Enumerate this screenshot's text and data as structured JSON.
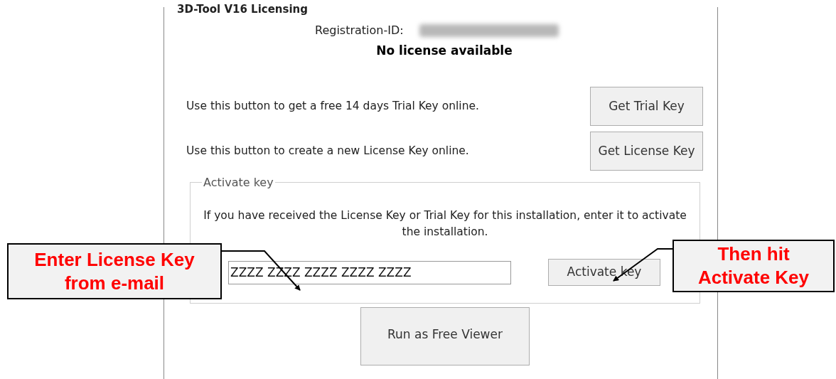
{
  "dialog": {
    "title": "3D-Tool V16 Licensing",
    "registration_label": "Registration-ID:",
    "status": "No license available",
    "actions": [
      {
        "text": "Use this button to get a free 14 days Trial Key online.",
        "button": "Get Trial Key"
      },
      {
        "text": "Use this button to create a new License Key online.",
        "button": "Get License Key"
      }
    ],
    "activate_group": {
      "legend": "Activate key",
      "description": "If you have received the License Key or Trial Key for this installation, enter it to activate the installation.",
      "key_value": "ZZZZ ZZZZ ZZZZ ZZZZ ZZZZ",
      "button": "Activate key"
    },
    "viewer_button": "Run as Free Viewer"
  },
  "callouts": [
    {
      "lines": [
        "Enter License Key",
        "from e-mail"
      ]
    },
    {
      "lines": [
        "Then hit",
        "Activate Key"
      ]
    }
  ]
}
